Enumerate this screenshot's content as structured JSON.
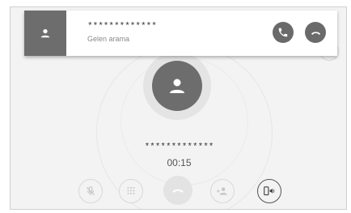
{
  "notification": {
    "caller_number": "*************",
    "subtitle": "Gelen arama",
    "avatar_icon": "person-icon",
    "accept_icon": "phone-answer-icon",
    "decline_icon": "phone-hangup-icon"
  },
  "call": {
    "caller_number": "*************",
    "duration": "00:15",
    "avatar_icon": "person-icon"
  },
  "controls": [
    {
      "name": "mute",
      "icon": "mic-off-icon"
    },
    {
      "name": "keypad",
      "icon": "keypad-icon"
    },
    {
      "name": "end-call",
      "icon": "phone-hangup-icon"
    },
    {
      "name": "add-participant",
      "icon": "add-person-icon"
    },
    {
      "name": "audio-output",
      "icon": "phone-speaker-icon"
    }
  ],
  "colors": {
    "background": "#f3f3f3",
    "avatar": "#6d6d6d",
    "notification_bg": "#ffffff",
    "action_button": "#6a6a6a",
    "disabled": "#c8c8c8"
  }
}
